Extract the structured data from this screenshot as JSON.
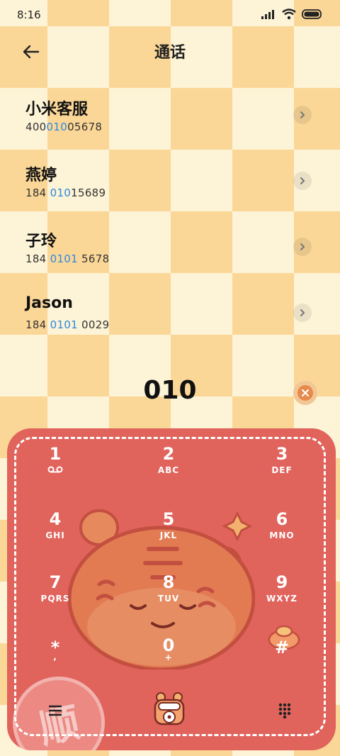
{
  "status": {
    "time": "8:16"
  },
  "header": {
    "title": "通话"
  },
  "contacts": [
    {
      "name": "小米客服",
      "num_pre": "400",
      "num_hl": "010",
      "num_post": "05678"
    },
    {
      "name": "燕婷",
      "num_pre": "184 ",
      "num_hl": "010",
      "num_post": "15689"
    },
    {
      "name": "子玲",
      "num_pre": "184 ",
      "num_hl": "0101",
      "num_post": " 5678"
    },
    {
      "name": "Jason",
      "num_pre": "184 ",
      "num_hl": "0101",
      "num_post": " 0029"
    }
  ],
  "dialer": {
    "typed": "010",
    "keys": [
      {
        "digit": "1",
        "letters": ""
      },
      {
        "digit": "2",
        "letters": "ABC"
      },
      {
        "digit": "3",
        "letters": "DEF"
      },
      {
        "digit": "4",
        "letters": "GHI"
      },
      {
        "digit": "5",
        "letters": "JKL"
      },
      {
        "digit": "6",
        "letters": "MNO"
      },
      {
        "digit": "7",
        "letters": "PQRS"
      },
      {
        "digit": "8",
        "letters": "TUV"
      },
      {
        "digit": "9",
        "letters": "WXYZ"
      },
      {
        "digit": "*",
        "letters": ","
      },
      {
        "digit": "0",
        "letters": "+"
      },
      {
        "digit": "#",
        "letters": ""
      }
    ],
    "stamp_char": "顺"
  },
  "icons": {
    "back": "back-arrow-icon",
    "chevron": "chevron-right-icon",
    "delete": "backspace-icon",
    "voicemail": "voicemail-icon",
    "menu": "menu-icon",
    "call": "call-icon",
    "keypad": "keypad-icon"
  },
  "colors": {
    "highlight": "#2a8ae0",
    "dialpad_bg": "#e0635c",
    "check_dark": "#fbd797",
    "check_light": "#fdf3d6"
  }
}
